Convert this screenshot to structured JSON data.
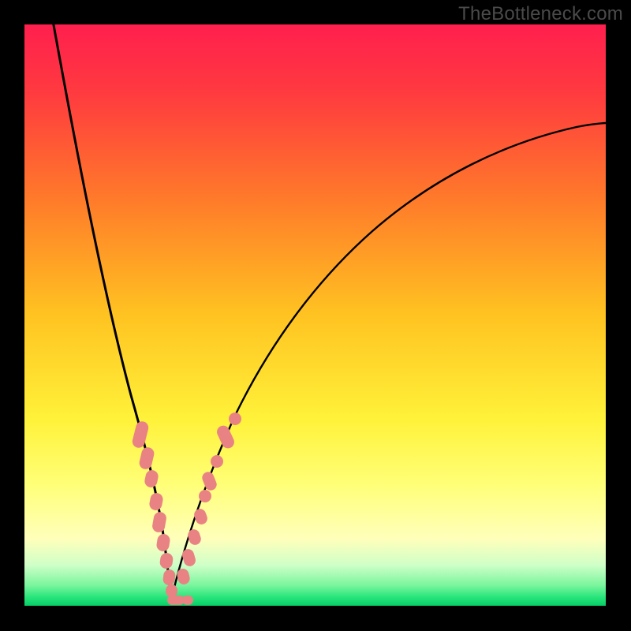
{
  "watermark": "TheBottleneck.com",
  "colors": {
    "frame_bg": "#000000",
    "gradient_stops": [
      {
        "offset": 0.0,
        "color": "#ff1f4e"
      },
      {
        "offset": 0.12,
        "color": "#ff3b3f"
      },
      {
        "offset": 0.3,
        "color": "#ff7a2a"
      },
      {
        "offset": 0.5,
        "color": "#ffc321"
      },
      {
        "offset": 0.68,
        "color": "#fff23a"
      },
      {
        "offset": 0.79,
        "color": "#ffff77"
      },
      {
        "offset": 0.885,
        "color": "#ffffbb"
      },
      {
        "offset": 0.93,
        "color": "#cfffc8"
      },
      {
        "offset": 0.965,
        "color": "#7af59d"
      },
      {
        "offset": 0.985,
        "color": "#29e57b"
      },
      {
        "offset": 1.0,
        "color": "#05cf66"
      }
    ],
    "curve": "#000000",
    "marker": "#e98383"
  },
  "chart_data": {
    "type": "line",
    "title": "",
    "xlabel": "",
    "ylabel": "",
    "xlim": [
      0,
      100
    ],
    "ylim": [
      0,
      100
    ],
    "minimum_x": 25,
    "series": [
      {
        "name": "left-branch",
        "x": [
          5,
          8,
          11,
          14,
          16,
          18,
          20,
          21.5,
          23,
          24,
          25
        ],
        "y": [
          100,
          82,
          67,
          54,
          44.5,
          36,
          28,
          21,
          13,
          6,
          0.5
        ]
      },
      {
        "name": "right-branch",
        "x": [
          25,
          27,
          29,
          31.5,
          35,
          40,
          47,
          55,
          64,
          74,
          85,
          95,
          100
        ],
        "y": [
          0.5,
          6,
          12,
          19,
          27,
          37,
          48,
          57.5,
          65.5,
          72,
          77.5,
          81.5,
          83
        ]
      }
    ],
    "markers": {
      "name": "highlighted-points",
      "style": "pill",
      "points_left_branch": [
        {
          "x": 19.8,
          "y": 29.5
        },
        {
          "x": 20.8,
          "y": 25.0
        },
        {
          "x": 21.5,
          "y": 21.0
        },
        {
          "x": 22.3,
          "y": 17.0
        },
        {
          "x": 22.9,
          "y": 13.5
        },
        {
          "x": 23.4,
          "y": 10.5
        },
        {
          "x": 23.9,
          "y": 7.5
        },
        {
          "x": 24.3,
          "y": 5.0
        },
        {
          "x": 24.7,
          "y": 2.8
        },
        {
          "x": 25.0,
          "y": 1.2
        }
      ],
      "points_bottom": [
        {
          "x": 25.3,
          "y": 0.8
        },
        {
          "x": 26.3,
          "y": 0.8
        },
        {
          "x": 27.2,
          "y": 0.8
        }
      ],
      "points_right_branch": [
        {
          "x": 27.4,
          "y": 5.0
        },
        {
          "x": 28.0,
          "y": 8.5
        },
        {
          "x": 28.8,
          "y": 12.0
        },
        {
          "x": 29.7,
          "y": 15.5
        },
        {
          "x": 30.6,
          "y": 18.5
        },
        {
          "x": 32.0,
          "y": 22.5
        },
        {
          "x": 32.8,
          "y": 24.5
        },
        {
          "x": 34.8,
          "y": 29.0
        },
        {
          "x": 35.8,
          "y": 31.0
        }
      ]
    }
  }
}
